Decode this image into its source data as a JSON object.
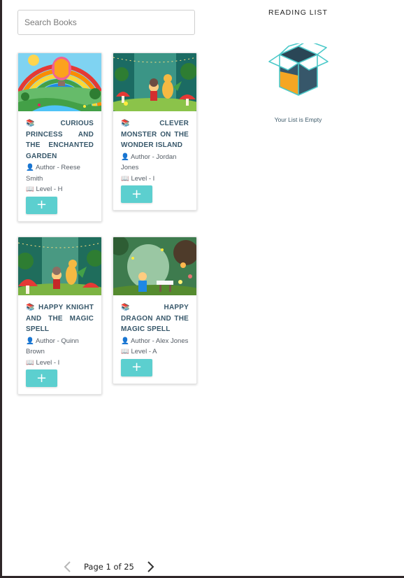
{
  "search": {
    "placeholder": "Search Books",
    "value": ""
  },
  "books": [
    {
      "title": "CURIOUS PRINCESS AND THE ENCHANTED GARDEN",
      "author": "Author - Reese Smith",
      "level": "Level - H",
      "add_label": "+"
    },
    {
      "title": "CLEVER MONSTER ON THE WONDER ISLAND",
      "author": "Author - Jordan Jones",
      "level": "Level - I",
      "add_label": "+"
    },
    {
      "title": "HAPPY KNIGHT AND THE MAGIC SPELL",
      "author": "Author - Quinn Brown",
      "level": "Level - I",
      "add_label": "+"
    },
    {
      "title": "HAPPY DRAGON AND THE MAGIC SPELL",
      "author": "Author - Alex Jones",
      "level": "Level - A",
      "add_label": "+"
    }
  ],
  "icons": {
    "title": "📚",
    "author": "👤",
    "level": "📖"
  },
  "reading_list": {
    "title": "READING LIST",
    "empty_message": "Your List is Empty"
  },
  "pagination": {
    "label": "Page 1 of 25"
  },
  "colors": {
    "accent": "#5ccfcf",
    "title": "#37576a",
    "box_dark": "#37576a",
    "box_orange": "#f5a623"
  }
}
